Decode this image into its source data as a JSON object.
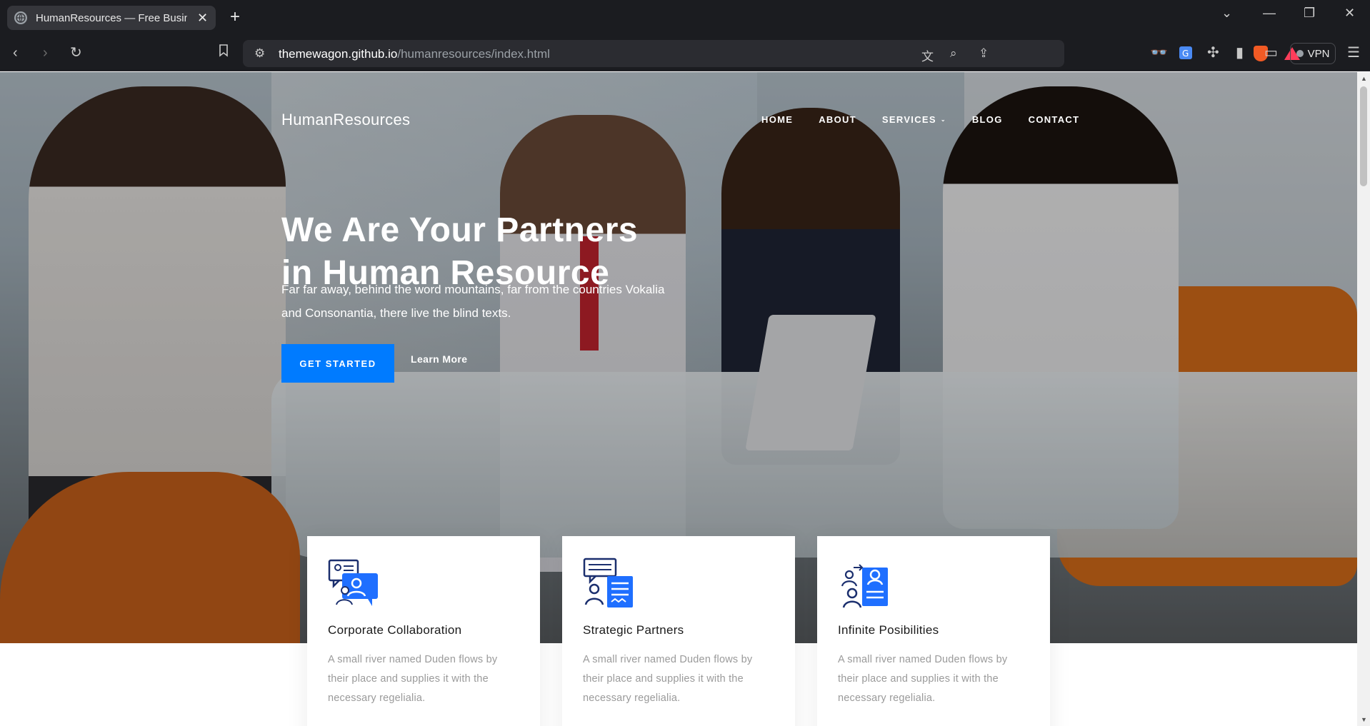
{
  "browser": {
    "tab_title": "HumanResources — Free Busine",
    "url_host": "themewagon.github.io",
    "url_path": "/humanresources/index.html",
    "vpn_label": "VPN",
    "new_tab_glyph": "+",
    "tab_close_glyph": "✕"
  },
  "site": {
    "brand": "HumanResources",
    "nav": [
      {
        "label": "HOME"
      },
      {
        "label": "ABOUT"
      },
      {
        "label": "SERVICES"
      },
      {
        "label": "BLOG"
      },
      {
        "label": "CONTACT"
      }
    ],
    "hero": {
      "title_line1": "We Are Your Partners",
      "title_line2_prefix": "in ",
      "title_line2_strong": "Human Resource",
      "subtitle": "Far far away, behind the word mountains, far from the countries Vokalia and Consonantia, there live the blind texts.",
      "primary_button": "GET STARTED",
      "secondary_link": "Learn More"
    },
    "cards": [
      {
        "title": "Corporate Collaboration",
        "text": "A small river named Duden flows by their place and supplies it with the necessary regelialia.",
        "icon": "collaboration-icon"
      },
      {
        "title": "Strategic Partners",
        "text": "A small river named Duden flows by their place and supplies it with the necessary regelialia.",
        "icon": "strategy-icon"
      },
      {
        "title": "Infinite Posibilities",
        "text": "A small river named Duden flows by their place and supplies it with the necessary regelialia.",
        "icon": "possibilities-icon"
      }
    ]
  },
  "colors": {
    "accent": "#007bff",
    "icon_dark": "#1b2f6e",
    "icon_blue": "#1f6fff"
  }
}
